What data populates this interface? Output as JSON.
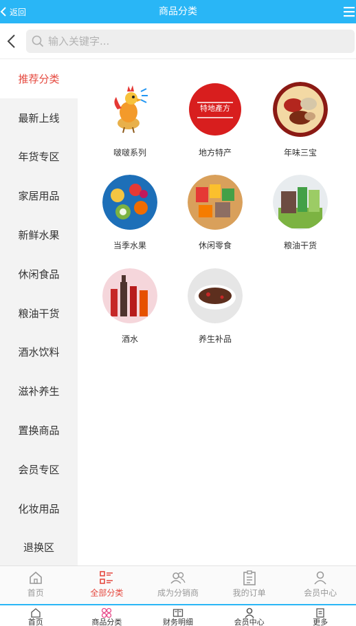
{
  "header": {
    "back_label": "返回",
    "title": "商品分类",
    "accent": "#29b6f6"
  },
  "search": {
    "placeholder": "输入关键字..."
  },
  "sidebar": {
    "active_color": "#e5483e",
    "items": [
      {
        "label": "推荐分类",
        "active": true
      },
      {
        "label": "最新上线"
      },
      {
        "label": "年货专区"
      },
      {
        "label": "家居用品"
      },
      {
        "label": "新鲜水果"
      },
      {
        "label": "休闲食品"
      },
      {
        "label": "粮油干货"
      },
      {
        "label": "酒水饮料"
      },
      {
        "label": "滋补养生"
      },
      {
        "label": "置换商品"
      },
      {
        "label": "会员专区"
      },
      {
        "label": "化妆用品"
      },
      {
        "label": "退换区"
      }
    ]
  },
  "categories": [
    {
      "label": "啵啵系列",
      "icon": "rooster-icon"
    },
    {
      "label": "地方特产",
      "icon": "stamp-logo-icon",
      "stamp_text": "特地產方"
    },
    {
      "label": "年味三宝",
      "icon": "cured-meat-icon"
    },
    {
      "label": "当季水果",
      "icon": "fruit-icon"
    },
    {
      "label": "休闲零食",
      "icon": "snacks-icon"
    },
    {
      "label": "粮油干货",
      "icon": "grain-oil-icon"
    },
    {
      "label": "酒水",
      "icon": "wine-bottles-icon"
    },
    {
      "label": "养生补品",
      "icon": "herbal-soup-icon"
    }
  ],
  "bottom_nav": [
    {
      "label": "首页",
      "icon": "home-icon"
    },
    {
      "label": "全部分类",
      "icon": "category-list-icon",
      "active": true
    },
    {
      "label": "成为分销商",
      "icon": "users-icon"
    },
    {
      "label": "我的订单",
      "icon": "clipboard-icon"
    },
    {
      "label": "会员中心",
      "icon": "user-icon"
    }
  ],
  "bottom_nav_secondary": [
    {
      "label": "首页",
      "icon": "home-icon"
    },
    {
      "label": "商品分类",
      "icon": "grid-circles-icon"
    },
    {
      "label": "财务明细",
      "icon": "book-icon"
    },
    {
      "label": "会员中心",
      "icon": "user-icon"
    },
    {
      "label": "更多",
      "icon": "note-icon"
    }
  ]
}
